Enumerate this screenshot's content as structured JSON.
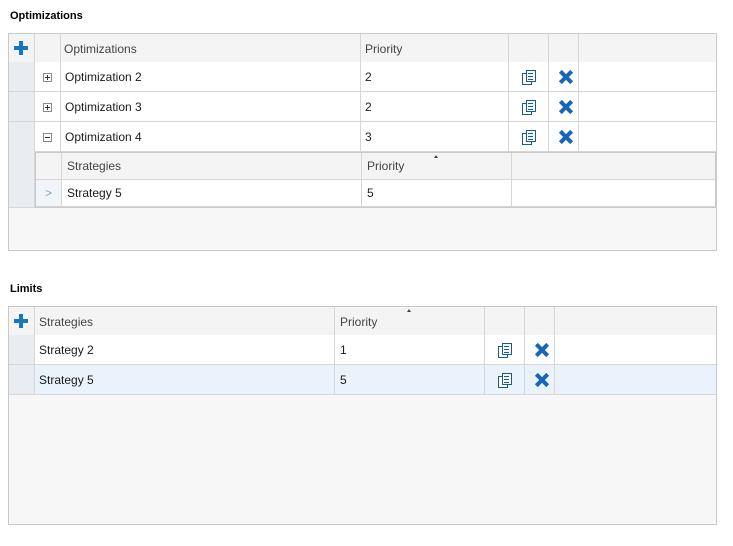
{
  "optimizations": {
    "title": "Optimizations",
    "header": {
      "name": "Optimizations",
      "priority": "Priority"
    },
    "rows": [
      {
        "name": "Optimization 2",
        "priority": "2"
      },
      {
        "name": "Optimization 3",
        "priority": "2"
      },
      {
        "name": "Optimization 4",
        "priority": "3"
      }
    ],
    "nested": {
      "header": {
        "name": "Strategies",
        "priority": "Priority"
      },
      "rows": [
        {
          "name": "Strategy 5",
          "priority": "5"
        }
      ]
    }
  },
  "limits": {
    "title": "Limits",
    "header": {
      "name": "Strategies",
      "priority": "Priority"
    },
    "rows": [
      {
        "name": "Strategy 2",
        "priority": "1"
      },
      {
        "name": "Strategy 5",
        "priority": "5"
      }
    ]
  },
  "colors": {
    "accent": "#1877c5",
    "selected_row": "#eaf3fb"
  },
  "icons": {
    "add": "plus-icon",
    "copy": "copy-icon",
    "delete": "delete-icon",
    "expand": "expand-icon",
    "collapse": "collapse-icon",
    "row_indicator": "chevron-right-icon"
  }
}
